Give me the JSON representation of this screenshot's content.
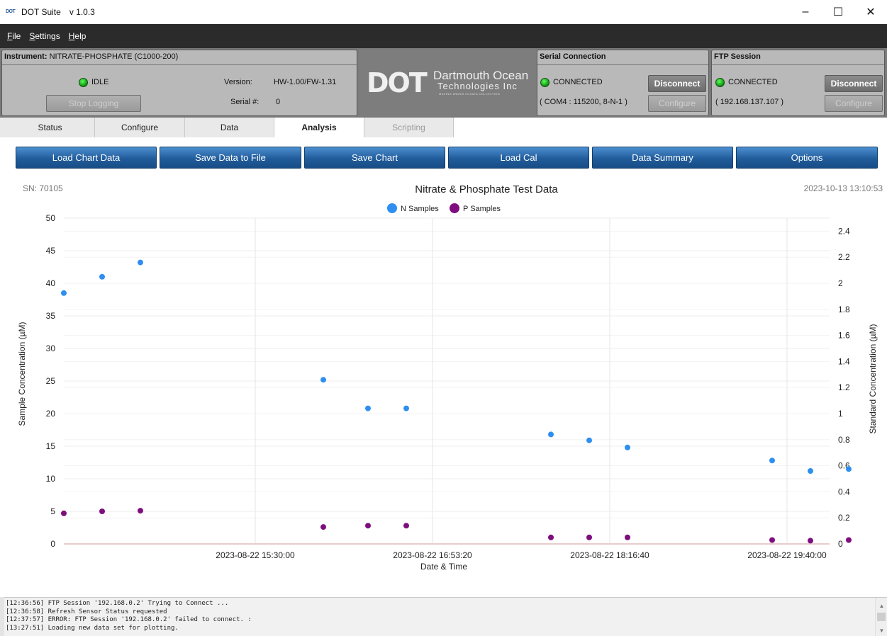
{
  "window": {
    "app_name": "DOT Suite",
    "version": "v 1.0.3",
    "logo_text": "DOT",
    "controls": {
      "minimize": "–",
      "maximize": "☐",
      "close": "✕"
    }
  },
  "menu": [
    {
      "underline": "F",
      "rest": "ile"
    },
    {
      "underline": "S",
      "rest": "ettings"
    },
    {
      "underline": "H",
      "rest": "elp"
    }
  ],
  "instrument": {
    "label": "Instrument:",
    "name": "NITRATE-PHOSPHATE (C1000-200)",
    "status": "IDLE",
    "stop_logging_label": "Stop Logging",
    "version_label": "Version:",
    "version_value": "HW-1.00/FW-1.31",
    "serial_label": "Serial #:",
    "serial_value": "0"
  },
  "logo": {
    "mark": "DOT",
    "line1": "Dartmouth Ocean",
    "line2": "Technologies Inc",
    "tagline": "MAKING WAVES IN DATA COLLECTION"
  },
  "serial_connection": {
    "title": "Serial Connection",
    "status": "CONNECTED",
    "details": "( COM4 : 115200, 8-N-1 )",
    "disconnect_label": "Disconnect",
    "configure_label": "Configure"
  },
  "ftp_session": {
    "title": "FTP Session",
    "status": "CONNECTED",
    "details": "( 192.168.137.107 )",
    "disconnect_label": "Disconnect",
    "configure_label": "Configure"
  },
  "tabs": [
    {
      "label": "Status",
      "state": "normal"
    },
    {
      "label": "Configure",
      "state": "normal"
    },
    {
      "label": "Data",
      "state": "normal"
    },
    {
      "label": "Analysis",
      "state": "active"
    },
    {
      "label": "Scripting",
      "state": "disabled"
    }
  ],
  "toolbar": [
    {
      "label": "Load Chart Data"
    },
    {
      "label": "Save Data to File"
    },
    {
      "label": "Save Chart"
    },
    {
      "label": "Load Cal"
    },
    {
      "label": "Data Summary"
    },
    {
      "label": "Options"
    }
  ],
  "chart_header": {
    "sn": "SN:   70105",
    "timestamp": "2023-10-13 13:10:53"
  },
  "colors": {
    "n_samples": "#2f8ff0",
    "p_samples": "#7e0e7e",
    "toolbar_button": "#215c9b",
    "menu_bar": "#2b2b2b",
    "led_green": "#15b015"
  },
  "chart_data": {
    "type": "scatter",
    "title": "Nitrate & Phosphate Test Data",
    "xlabel": "Date & Time",
    "ylabel": "Sample Concentration (µM)",
    "y2label": "Standard Concentration (µM)",
    "ylim": [
      0,
      50
    ],
    "y2lim": [
      0,
      2.5
    ],
    "yticks": [
      "0",
      "5",
      "10",
      "15",
      "20",
      "25",
      "30",
      "35",
      "40",
      "45",
      "50"
    ],
    "y2ticks": [
      "0",
      "0.2",
      "0.4",
      "0.6",
      "0.8",
      "1",
      "1.2",
      "1.4",
      "1.6",
      "1.8",
      "2",
      "2.2",
      "2.4"
    ],
    "xlim": [
      "2023-08-22 14:00:00",
      "2023-08-22 20:00:00"
    ],
    "xticks": [
      "2023-08-22 15:30:00",
      "2023-08-22 16:53:20",
      "2023-08-22 18:16:40",
      "2023-08-22 19:40:00"
    ],
    "grid": true,
    "legend": "top-center",
    "series": [
      {
        "name": "N Samples",
        "color": "#2f8ff0",
        "points": [
          [
            "2023-08-22 14:00:00",
            38.5
          ],
          [
            "2023-08-22 14:18:00",
            41.0
          ],
          [
            "2023-08-22 14:36:00",
            43.2
          ],
          [
            "2023-08-22 16:02:00",
            25.2
          ],
          [
            "2023-08-22 16:23:00",
            20.8
          ],
          [
            "2023-08-22 16:41:00",
            20.8
          ],
          [
            "2023-08-22 17:49:00",
            16.8
          ],
          [
            "2023-08-22 18:07:00",
            15.9
          ],
          [
            "2023-08-22 18:25:00",
            14.8
          ],
          [
            "2023-08-22 19:33:00",
            12.8
          ],
          [
            "2023-08-22 19:51:00",
            11.2
          ],
          [
            "2023-08-22 20:09:00",
            11.5
          ]
        ]
      },
      {
        "name": "P Samples",
        "color": "#7e0e7e",
        "points": [
          [
            "2023-08-22 14:00:00",
            4.7
          ],
          [
            "2023-08-22 14:18:00",
            5.0
          ],
          [
            "2023-08-22 14:36:00",
            5.1
          ],
          [
            "2023-08-22 16:02:00",
            2.6
          ],
          [
            "2023-08-22 16:23:00",
            2.8
          ],
          [
            "2023-08-22 16:41:00",
            2.8
          ],
          [
            "2023-08-22 17:49:00",
            1.0
          ],
          [
            "2023-08-22 18:07:00",
            1.0
          ],
          [
            "2023-08-22 18:25:00",
            1.0
          ],
          [
            "2023-08-22 19:33:00",
            0.6
          ],
          [
            "2023-08-22 19:51:00",
            0.5
          ],
          [
            "2023-08-22 20:09:00",
            0.6
          ]
        ]
      }
    ]
  },
  "log": [
    "[12:36:56] FTP Session '192.168.0.2' Trying to Connect ...",
    "[12:36:58] Refresh Sensor Status requested",
    "[12:37:57] ERROR:  FTP Session '192.168.0.2' failed to connect. :",
    "[13:27:51] Loading new data set for plotting."
  ]
}
